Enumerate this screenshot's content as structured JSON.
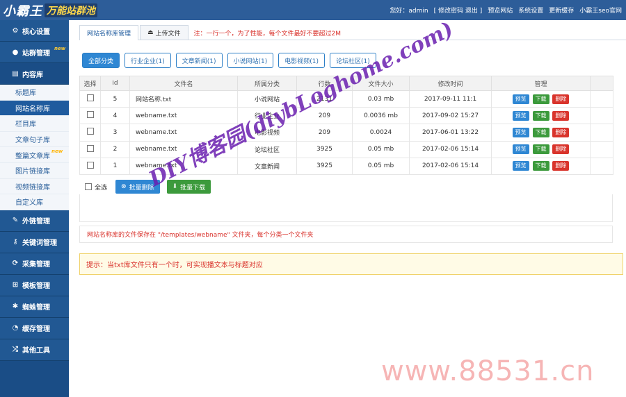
{
  "header": {
    "logo_main": "小霸王",
    "logo_sub": "万能站群池",
    "links": [
      "您好：admin",
      "[ 修改密码 退出 ]",
      "预览网站",
      "系统设置",
      "更新缓存",
      "小霸王seo官网"
    ]
  },
  "sidebar": {
    "items": [
      {
        "label": "核心设置",
        "icon": "gear-icon",
        "glyph": "⚙"
      },
      {
        "label": "站群管理",
        "icon": "user-icon",
        "glyph": "👤",
        "tag": "new"
      },
      {
        "label": "内容库",
        "icon": "document-icon",
        "glyph": "▤"
      }
    ],
    "sub_items": [
      {
        "label": "标题库"
      },
      {
        "label": "网站名称库",
        "active": true
      },
      {
        "label": "栏目库"
      },
      {
        "label": "文章句子库"
      },
      {
        "label": "整篇文章库",
        "tag": "new"
      },
      {
        "label": "图片链接库"
      },
      {
        "label": "视频链接库"
      },
      {
        "label": "自定义库"
      }
    ],
    "more_items": [
      {
        "label": "外链管理",
        "icon": "link-icon",
        "glyph": "🔗"
      },
      {
        "label": "关键词管理",
        "icon": "key-icon",
        "glyph": "🔑"
      },
      {
        "label": "采集管理",
        "icon": "refresh-icon",
        "glyph": "⟳"
      },
      {
        "label": "模板管理",
        "icon": "windows-icon",
        "glyph": "⊞"
      },
      {
        "label": "蜘蛛管理",
        "icon": "android-icon",
        "glyph": "✱"
      },
      {
        "label": "缓存管理",
        "icon": "dashboard-icon",
        "glyph": "◔"
      },
      {
        "label": "其他工具",
        "icon": "shuffle-icon",
        "glyph": "⤮"
      }
    ]
  },
  "tabs": [
    {
      "label": "网站名称库管理",
      "active": true
    },
    {
      "label": "上传文件",
      "icon": "upload-icon"
    }
  ],
  "tab_note": "注：一行一个，为了性能，每个文件最好不要超过2M",
  "categories": [
    "全部分类",
    "行业企业(1)",
    "文章新闻(1)",
    "小说网站(1)",
    "电影视频(1)",
    "论坛社区(1)"
  ],
  "table": {
    "headers": [
      "选择",
      "id",
      "文件名",
      "所属分类",
      "行数",
      "文件大小",
      "修改时间",
      "管理"
    ],
    "rows": [
      {
        "id": "5",
        "file": "网站名称.txt",
        "category": "小说网站",
        "lines": "2131",
        "size": "0.03 mb",
        "time": "2017-09-11 11:1"
      },
      {
        "id": "4",
        "file": "webname.txt",
        "category": "行业企业",
        "lines": "209",
        "size": "0.0036 mb",
        "time": "2017-09-02 15:27"
      },
      {
        "id": "3",
        "file": "webname.txt",
        "category": "电影视频",
        "lines": "209",
        "size": "0.0024",
        "time": "2017-06-01 13:22"
      },
      {
        "id": "2",
        "file": "webname.txt",
        "category": "论坛社区",
        "lines": "3925",
        "size": "0.05 mb",
        "time": "2017-02-06 15:14"
      },
      {
        "id": "1",
        "file": "webname.txt",
        "category": "文章新闻",
        "lines": "3925",
        "size": "0.05 mb",
        "time": "2017-02-06 15:14"
      }
    ],
    "actions": {
      "preview": "预览",
      "download": "下载",
      "delete": "删除"
    }
  },
  "bulk": {
    "select_all": "全选",
    "delete": "批量删除",
    "download": "批量下载"
  },
  "info_text": "网站名称库的文件保存在 \"/templates/webname\" 文件夹，每个分类一个文件夹",
  "tip_text": "提示：当txt库文件只有一个时，可实现播文本与标题对应",
  "watermark": "DIY博客园(diybLoghome.com)",
  "site_mark": "www.88531.cn",
  "colors": {
    "header": "#2d5d99",
    "sidebar": "#1a4d86",
    "accent": "#2f87d3",
    "danger": "#d9342c",
    "success": "#3c9a3c"
  }
}
